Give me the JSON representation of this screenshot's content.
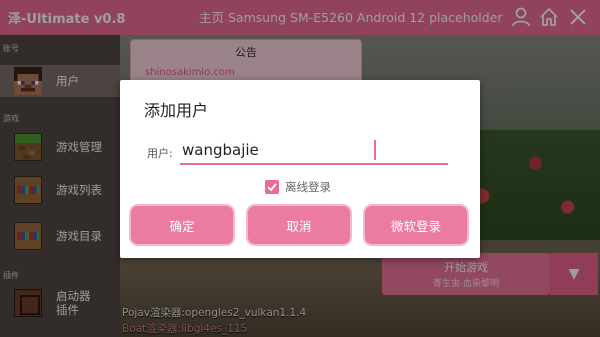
{
  "app": {
    "title": "泽-Ultimate v0.8",
    "header_text": "主页  Samsung SM-E5260 Android 12  placeholder",
    "icons": [
      "person-icon",
      "home-icon",
      "close-icon"
    ],
    "accent_color": "#e96c93"
  },
  "sidebar": {
    "section_account": "账号",
    "user_label": "用户",
    "section_game": "游戏",
    "game_items": [
      "游戏管理",
      "游戏列表",
      "游戏目录"
    ],
    "section_plugin": "插件",
    "launcher_plugin_label": "启动器插件"
  },
  "notice": {
    "title": "公告",
    "link": "shinosakimio.com"
  },
  "launch": {
    "start_label": "开始游戏",
    "version": "寄生虫-血染黎明",
    "arrow": "▼"
  },
  "renderers": {
    "pojav": "Pojav渲染器:opengles2_vulkan1.1.4",
    "boat": "Boat渲染器:libgl4es_115"
  },
  "dialog": {
    "title": "添加用户",
    "field_label": "用户:",
    "username": "wangbajie",
    "offline_label": "离线登录",
    "offline_checked": true,
    "buttons": [
      "确定",
      "取消",
      "微软登录"
    ]
  }
}
